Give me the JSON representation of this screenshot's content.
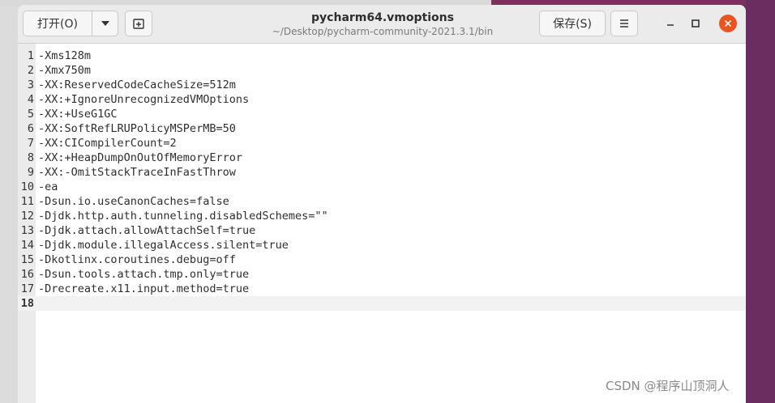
{
  "toolbar": {
    "open_label": "打开(O)",
    "save_label": "保存(S)"
  },
  "header": {
    "title": "pycharm64.vmoptions",
    "subtitle": "~/Desktop/pycharm-community-2021.3.1/bin"
  },
  "editor": {
    "current_line": 18,
    "lines": [
      {
        "num": "1",
        "text": "-Xms128m"
      },
      {
        "num": "2",
        "text": "-Xmx750m"
      },
      {
        "num": "3",
        "text": "-XX:ReservedCodeCacheSize=512m"
      },
      {
        "num": "4",
        "text": "-XX:+IgnoreUnrecognizedVMOptions"
      },
      {
        "num": "5",
        "text": "-XX:+UseG1GC"
      },
      {
        "num": "6",
        "text": "-XX:SoftRefLRUPolicyMSPerMB=50"
      },
      {
        "num": "7",
        "text": "-XX:CICompilerCount=2"
      },
      {
        "num": "8",
        "text": "-XX:+HeapDumpOnOutOfMemoryError"
      },
      {
        "num": "9",
        "text": "-XX:-OmitStackTraceInFastThrow"
      },
      {
        "num": "10",
        "text": "-ea"
      },
      {
        "num": "11",
        "text": "-Dsun.io.useCanonCaches=false"
      },
      {
        "num": "12",
        "text": "-Djdk.http.auth.tunneling.disabledSchemes=\"\""
      },
      {
        "num": "13",
        "text": "-Djdk.attach.allowAttachSelf=true"
      },
      {
        "num": "14",
        "text": "-Djdk.module.illegalAccess.silent=true"
      },
      {
        "num": "15",
        "text": "-Dkotlinx.coroutines.debug=off"
      },
      {
        "num": "16",
        "text": "-Dsun.tools.attach.tmp.only=true"
      },
      {
        "num": "17",
        "text": "-Drecreate.x11.input.method=true"
      },
      {
        "num": "18",
        "text": ""
      }
    ]
  },
  "watermark": "CSDN @程序山顶洞人",
  "colors": {
    "close_button": "#e95420",
    "headerbar": "#ebebeb",
    "desktop": "#6b2c5f"
  },
  "icons": {
    "dropdown": "chevron-down-icon",
    "new_tab": "new-tab-icon",
    "menu": "hamburger-menu-icon",
    "minimize": "minimize-icon",
    "maximize": "maximize-icon",
    "close": "close-icon"
  }
}
